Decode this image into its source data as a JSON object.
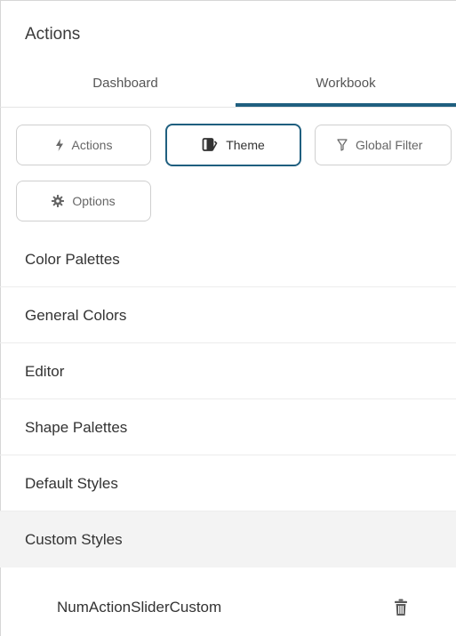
{
  "panel": {
    "title": "Actions"
  },
  "tabs": [
    {
      "label": "Dashboard",
      "active": false
    },
    {
      "label": "Workbook",
      "active": true
    }
  ],
  "buttons": {
    "actions": {
      "label": "Actions",
      "icon": "lightning-icon"
    },
    "theme": {
      "label": "Theme",
      "icon": "book-icon",
      "active": true
    },
    "global_filter": {
      "label": "Global Filter",
      "icon": "filter-icon"
    },
    "options": {
      "label": "Options",
      "icon": "gear-icon"
    }
  },
  "sections": [
    {
      "label": "Color Palettes"
    },
    {
      "label": "General Colors"
    },
    {
      "label": "Editor"
    },
    {
      "label": "Shape Palettes"
    },
    {
      "label": "Default Styles"
    },
    {
      "label": "Custom Styles",
      "selected": true
    }
  ],
  "custom_styles": {
    "items": [
      {
        "label": "NumActionSliderCustom",
        "action_icon": "trash-icon"
      }
    ]
  },
  "colors": {
    "accent": "#1f5f7f",
    "selected_row": "#f3f3f3"
  }
}
